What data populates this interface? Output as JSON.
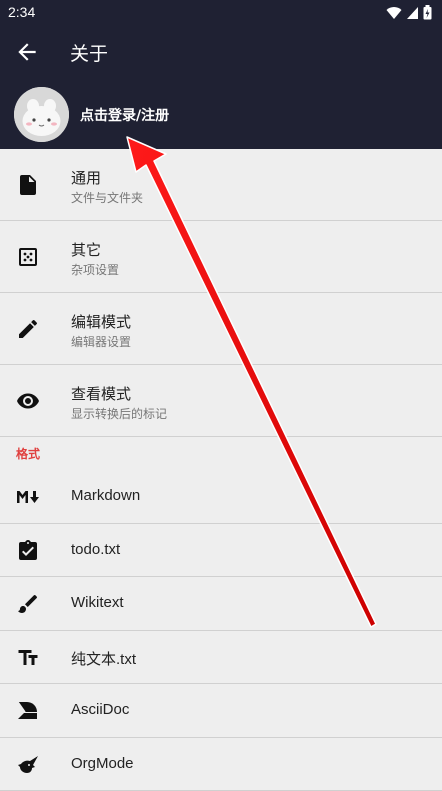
{
  "status_bar": {
    "time": "2:34"
  },
  "app_bar": {
    "title": "关于"
  },
  "profile": {
    "login_label": "点击登录/注册"
  },
  "settings": [
    {
      "title": "通用",
      "subtitle": "文件与文件夹",
      "icon": "file-icon"
    },
    {
      "title": "其它",
      "subtitle": "杂项设置",
      "icon": "dice-icon"
    },
    {
      "title": "编辑模式",
      "subtitle": "编辑器设置",
      "icon": "pencil-icon"
    },
    {
      "title": "查看模式",
      "subtitle": "显示转换后的标记",
      "icon": "eye-icon"
    }
  ],
  "formats_section": {
    "header": "格式"
  },
  "formats": [
    {
      "label": "Markdown",
      "icon": "markdown-icon"
    },
    {
      "label": "todo.txt",
      "icon": "clipboard-check-icon"
    },
    {
      "label": "Wikitext",
      "icon": "brush-icon"
    },
    {
      "label": "纯文本.txt",
      "icon": "text-format-icon"
    },
    {
      "label": "AsciiDoc",
      "icon": "asciidoc-icon"
    },
    {
      "label": "OrgMode",
      "icon": "unicorn-icon"
    }
  ],
  "colors": {
    "header_bg": "#1f2133",
    "list_bg": "#eeeeee",
    "section_accent": "#e0403f",
    "annotation_arrow": "#e8141c"
  }
}
